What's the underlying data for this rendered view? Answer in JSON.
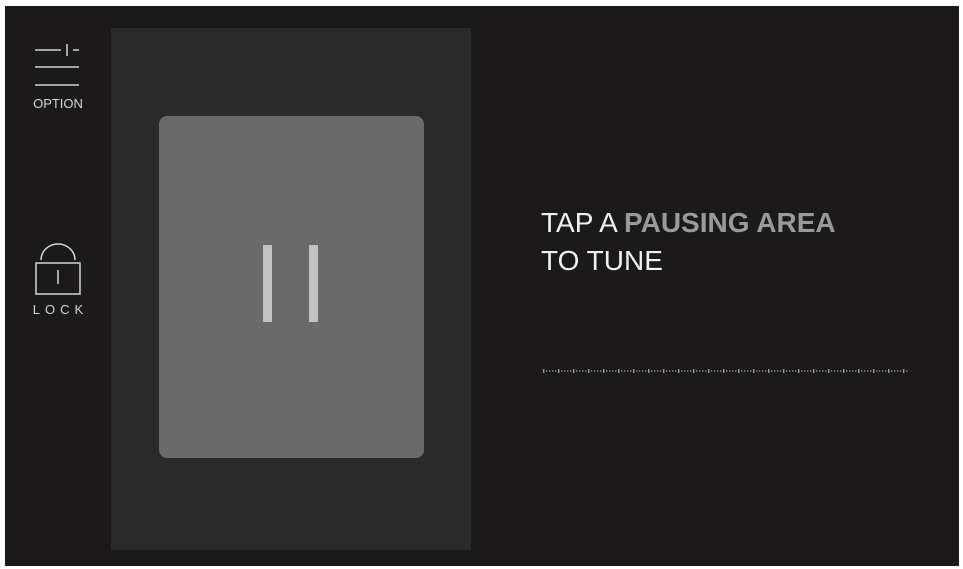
{
  "sidebar": {
    "option_label": "OPTION",
    "lock_label": "LOCK"
  },
  "instruction": {
    "line1_prefix": "TAP A ",
    "line1_highlight": "PAUSING AREA",
    "line2": "TO TUNE"
  },
  "colors": {
    "background": "#1b1919",
    "panel": "#2a2a2a",
    "pause_area": "#6a6a6a",
    "pause_bars": "#c2c2c2",
    "highlight": "#9a9a9a"
  },
  "icons": {
    "option": "sliders-icon",
    "lock": "lock-icon",
    "pause": "pause-icon"
  }
}
